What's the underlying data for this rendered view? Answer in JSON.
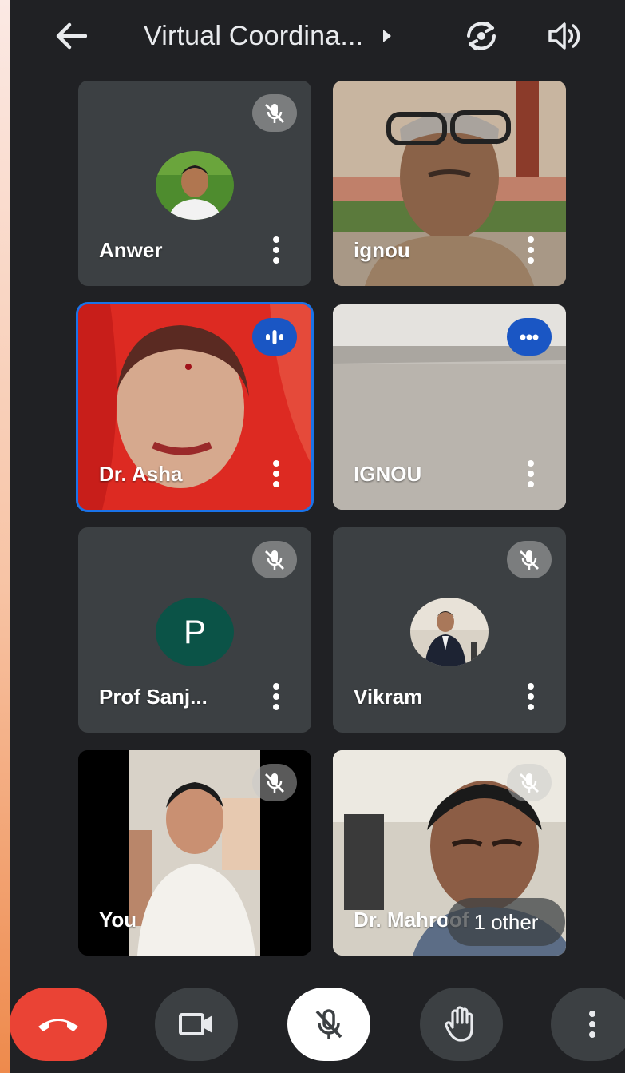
{
  "header": {
    "back_icon": "arrow-left-icon",
    "title": "Virtual Coordina...",
    "title_caret_icon": "caret-right-icon",
    "switch_camera_icon": "camera-flip-icon",
    "audio_icon": "speaker-icon"
  },
  "participants": [
    {
      "name": "Anwer",
      "state": "muted",
      "view": "avatar-photo"
    },
    {
      "name": "ignou",
      "state": "unmuted",
      "view": "video"
    },
    {
      "name": "Dr. Asha",
      "state": "speaking",
      "view": "video",
      "highlighted": true
    },
    {
      "name": "IGNOU",
      "state": "speaking",
      "view": "video"
    },
    {
      "name": "Prof Sanj...",
      "state": "muted",
      "view": "avatar-letter",
      "avatar_letter": "P"
    },
    {
      "name": "Vikram",
      "state": "muted",
      "view": "avatar-photo"
    },
    {
      "name": "You",
      "state": "muted",
      "view": "video"
    },
    {
      "name": "Dr. Mahroof",
      "state": "muted",
      "view": "video"
    }
  ],
  "overflow_badge": "1 other",
  "controls": {
    "hangup_icon": "phone-hangup-icon",
    "video_icon": "video-camera-icon",
    "mic_icon": "mic-off-icon",
    "hand_icon": "raise-hand-icon",
    "more_icon": "more-vertical-icon"
  },
  "colors": {
    "background": "#202124",
    "tile": "#3c4043",
    "active_outline": "#1a73e8",
    "hangup": "#ea4335",
    "avatar_letter_bg": "#0b5347"
  }
}
